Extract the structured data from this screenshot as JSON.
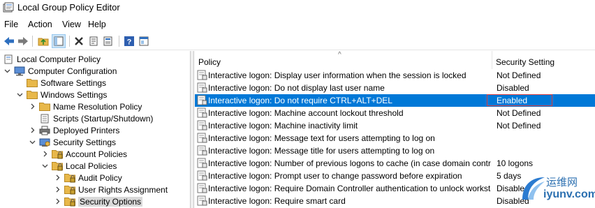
{
  "window": {
    "title": "Local Group Policy Editor"
  },
  "menu": {
    "file": "File",
    "action": "Action",
    "view": "View",
    "help": "Help"
  },
  "toolbar": {
    "buttons": [
      "back-icon",
      "forward-icon",
      "up-folder-icon",
      "show-hide-tree-icon",
      "delete-icon",
      "properties-icon",
      "export-list-icon",
      "help-icon",
      "console-icon"
    ]
  },
  "tree": {
    "items": [
      {
        "label": "Local Computer Policy"
      },
      {
        "label": "Computer Configuration"
      },
      {
        "label": "Software Settings"
      },
      {
        "label": "Windows Settings"
      },
      {
        "label": "Name Resolution Policy"
      },
      {
        "label": "Scripts (Startup/Shutdown)"
      },
      {
        "label": "Deployed Printers"
      },
      {
        "label": "Security Settings"
      },
      {
        "label": "Account Policies"
      },
      {
        "label": "Local Policies"
      },
      {
        "label": "Audit Policy"
      },
      {
        "label": "User Rights Assignment"
      },
      {
        "label": "Security Options"
      }
    ]
  },
  "list": {
    "columns": {
      "policy": "Policy",
      "setting": "Security Setting"
    },
    "rows": [
      {
        "policy": "Interactive logon: Display user information when the session is locked",
        "setting": "Not Defined"
      },
      {
        "policy": "Interactive logon: Do not display last user name",
        "setting": "Disabled"
      },
      {
        "policy": "Interactive logon: Do not require CTRL+ALT+DEL",
        "setting": "Enabled"
      },
      {
        "policy": "Interactive logon: Machine account lockout threshold",
        "setting": "Not Defined"
      },
      {
        "policy": "Interactive logon: Machine inactivity limit",
        "setting": "Not Defined"
      },
      {
        "policy": "Interactive logon: Message text for users attempting to log on",
        "setting": ""
      },
      {
        "policy": "Interactive logon: Message title for users attempting to log on",
        "setting": ""
      },
      {
        "policy": "Interactive logon: Number of previous logons to cache (in case domain controll...",
        "setting": "10 logons"
      },
      {
        "policy": "Interactive logon: Prompt user to change password before expiration",
        "setting": "5 days"
      },
      {
        "policy": "Interactive logon: Require Domain Controller authentication to unlock workstati...",
        "setting": "Disabled"
      },
      {
        "policy": "Interactive logon: Require smart card",
        "setting": "Disabled"
      }
    ]
  },
  "watermark": {
    "text": "运维网",
    "url_text": "iyunv.com"
  },
  "colors": {
    "selection": "#0078d7",
    "highlight_border": "#e04040",
    "folder": "#e8b84a"
  }
}
